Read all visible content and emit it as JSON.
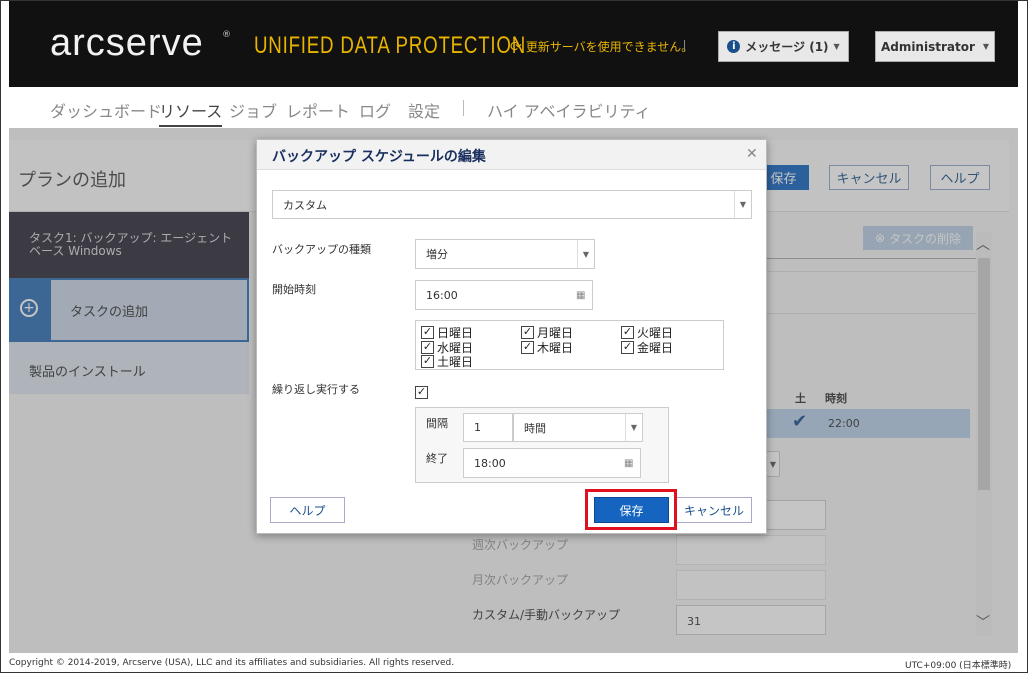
{
  "header": {
    "logo_text": "arcserve",
    "logo_reg": "®",
    "product_name": "UNIFIED DATA PROTECTION",
    "update_warning": "更新サーバを使用できません。",
    "messages_label": "メッセージ (1)",
    "user_label": "Administrator"
  },
  "nav": {
    "items": [
      "ダッシュボード",
      "リソース",
      "ジョブ",
      "レポート",
      "ログ",
      "設定",
      "ハイ アベイラビリティ"
    ],
    "active": "リソース"
  },
  "page": {
    "title": "プランの追加",
    "save_label": "保存",
    "cancel_label": "キャンセル",
    "help_label": "ヘルプ",
    "delete_task_label": "タスクの削除",
    "task1_line1": "タスク1: バックアップ: エージェント",
    "task1_line2": "ベース Windows",
    "add_task_label": "タスクの追加",
    "install_label": "製品のインストール",
    "col_sat": "土",
    "col_time": "時刻",
    "row_time": "22:00",
    "weekly_label": "週次バックアップ",
    "monthly_label": "月次バックアップ",
    "custom_label": "カスタム/手動バックアップ",
    "custom_value": "31"
  },
  "modal": {
    "title": "バックアップ スケジュールの編集",
    "schedule_type": "カスタム",
    "backup_type_label": "バックアップの種類",
    "backup_type_value": "増分",
    "start_time_label": "開始時刻",
    "start_time_value": "16:00",
    "days": [
      {
        "label": "日曜日",
        "checked": true
      },
      {
        "label": "月曜日",
        "checked": true
      },
      {
        "label": "火曜日",
        "checked": true
      },
      {
        "label": "水曜日",
        "checked": true
      },
      {
        "label": "木曜日",
        "checked": true
      },
      {
        "label": "金曜日",
        "checked": true
      },
      {
        "label": "土曜日",
        "checked": true
      }
    ],
    "repeat_label": "繰り返し実行する",
    "interval_label": "間隔",
    "interval_value": "1",
    "interval_unit": "時間",
    "end_label": "終了",
    "end_value": "18:00",
    "help_button": "ヘルプ",
    "save_button": "保存",
    "cancel_button": "キャンセル"
  },
  "footer": {
    "copyright": "Copyright © 2014-2019, Arcserve (USA), LLC and its affiliates and subsidiaries. All rights reserved.",
    "timezone": "UTC+09:00 (日本標準時)"
  },
  "colors": {
    "header_bg": "#111111",
    "brand_yellow": "#e8b400",
    "primary_blue": "#1565c0",
    "highlight_red": "#e01020"
  }
}
